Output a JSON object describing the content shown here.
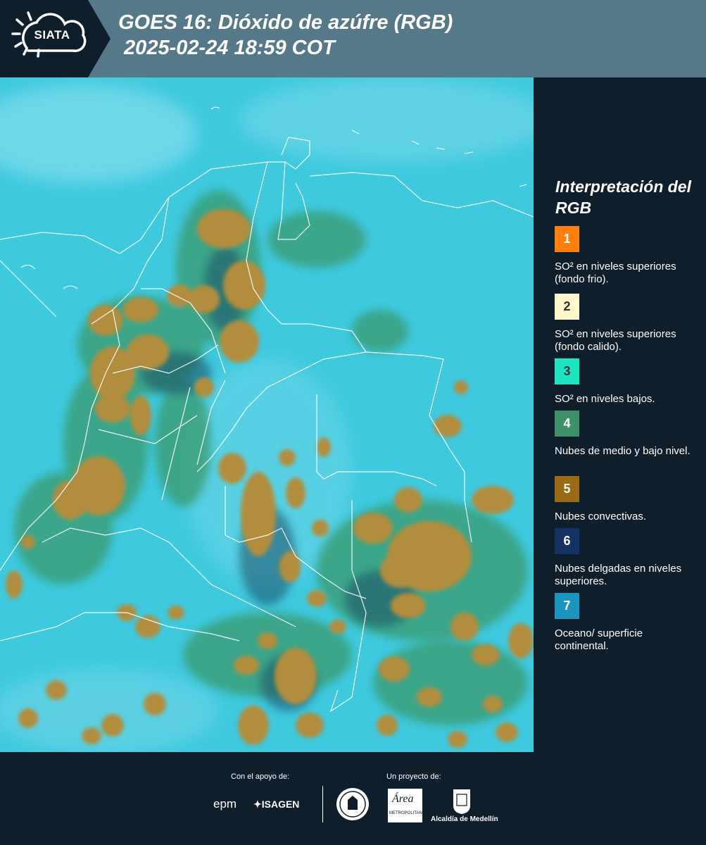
{
  "header": {
    "logo_text": "SIATA",
    "title_line1": "GOES 16: Dióxido de azúfre (RGB)",
    "title_line2": " 2025-02-24 18:59 COT"
  },
  "legend": {
    "title": "Interpretación del RGB",
    "items": [
      {
        "number": "1",
        "color": "#ff7f0e",
        "text_color": "#ffffff",
        "label": "SO² en niveles superiores (fondo frio)."
      },
      {
        "number": "2",
        "color": "#fff6c9",
        "text_color": "#333333",
        "label": "SO² en niveles superiores (fondo calido)."
      },
      {
        "number": "3",
        "color": "#1ce6c2",
        "text_color": "#333333",
        "label": "SO² en niveles bajos."
      },
      {
        "number": "4",
        "color": "#3f8f6b",
        "text_color": "#ffffff",
        "label": "Nubes de medio y bajo nivel."
      },
      {
        "number": "5",
        "color": "#9a6a14",
        "text_color": "#ffffff",
        "label": "Nubes convectivas."
      },
      {
        "number": "6",
        "color": "#123363",
        "text_color": "#ffffff",
        "label": "Nubes delgadas en niveles superiores."
      },
      {
        "number": "7",
        "color": "#1a95c0",
        "text_color": "#ffffff",
        "label": "Oceano/ superficie continental."
      }
    ]
  },
  "footer": {
    "support_label": "Con el apoyo de:",
    "project_label": "Un proyecto de:",
    "epm_text": "epm",
    "isagen_text": "ISAGEN",
    "metro_text": "Área",
    "metro_sub": "METROPOLITANA",
    "alcaldia_text": "Alcaldía de Medellín"
  },
  "colors": {
    "header_bg": "#56798a",
    "panel_bg": "#0e1e2b",
    "map_base": "#3ec9df",
    "cloud_convective": "#b28d3c",
    "cloud_low": "#3b9a6c",
    "border_line": "#ffffff"
  }
}
